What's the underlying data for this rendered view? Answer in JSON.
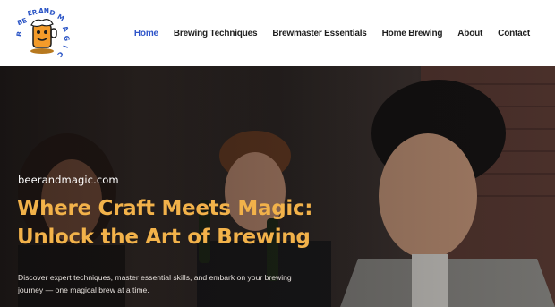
{
  "brand": {
    "logo_text": "BEERANDMAGIC",
    "logo_icon": "beer-mascot-icon"
  },
  "nav": {
    "items": [
      {
        "label": "Home",
        "active": true
      },
      {
        "label": "Brewing Techniques",
        "active": false
      },
      {
        "label": "Brewmaster Essentials",
        "active": false
      },
      {
        "label": "Home Brewing",
        "active": false
      },
      {
        "label": "About",
        "active": false
      },
      {
        "label": "Contact",
        "active": false
      }
    ]
  },
  "hero": {
    "site_name": "beerandmagic.com",
    "headline_line1": "Where Craft Meets Magic:",
    "headline_line2": "Unlock the Art of Brewing",
    "tagline": "Discover expert techniques, master essential skills, and embark on your brewing journey — one magical brew at a time."
  },
  "colors": {
    "nav_active": "#2f55c9",
    "nav_text": "#1e1e1e",
    "headline": "#f2b24a",
    "hero_text": "#ffffff"
  }
}
